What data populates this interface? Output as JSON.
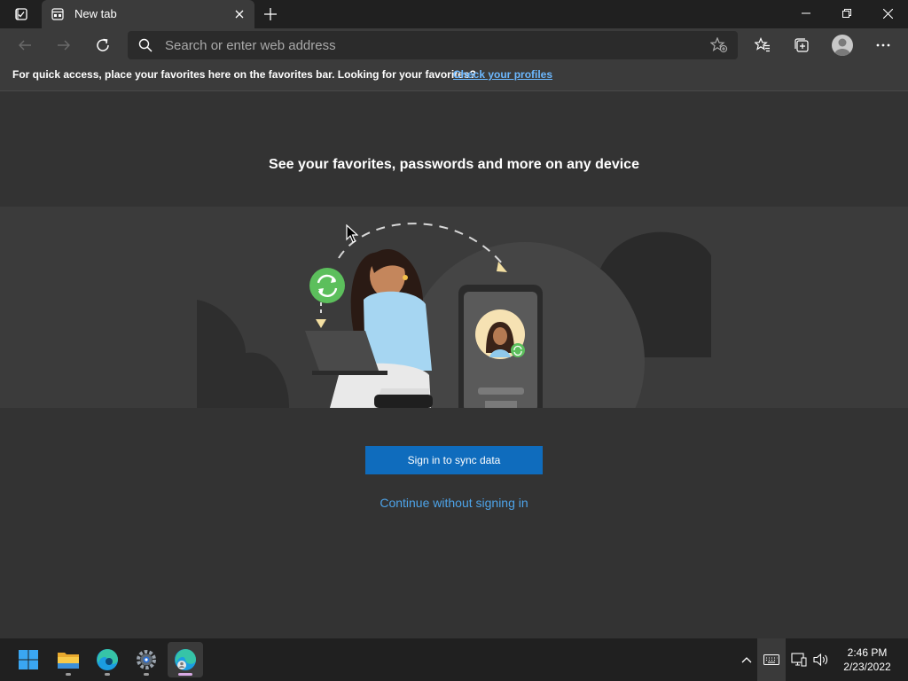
{
  "tabstrip": {
    "tab_title": "New tab"
  },
  "toolbar": {
    "search_placeholder": "Search or enter web address"
  },
  "favorites_bar": {
    "message": "For quick access, place your favorites here on the favorites bar. Looking for your favorites?",
    "link": "Check your profiles"
  },
  "main": {
    "headline": "See your favorites, passwords and more on any device",
    "signin_button": "Sign in to sync data",
    "continue_link": "Continue without signing in"
  },
  "taskbar": {
    "apps": [
      "start-icon",
      "file-explorer-icon",
      "edge-icon",
      "settings-icon",
      "edge-profile-icon"
    ],
    "time": "2:46 PM",
    "date": "2/23/2022"
  },
  "colors": {
    "accent": "#0f6cbd",
    "link": "#4da3e8",
    "background": "#333333",
    "chrome": "#202020"
  }
}
